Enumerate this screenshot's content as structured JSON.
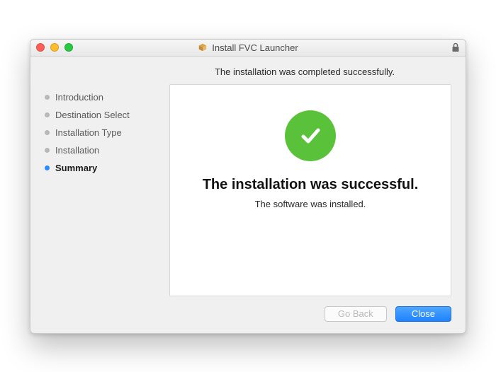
{
  "window": {
    "title": "Install FVC Launcher"
  },
  "status": "The installation was completed successfully.",
  "sidebar": {
    "items": [
      {
        "label": "Introduction",
        "active": false
      },
      {
        "label": "Destination Select",
        "active": false
      },
      {
        "label": "Installation Type",
        "active": false
      },
      {
        "label": "Installation",
        "active": false
      },
      {
        "label": "Summary",
        "active": true
      }
    ]
  },
  "panel": {
    "headline": "The installation was successful.",
    "subline": "The software was installed."
  },
  "buttons": {
    "back": "Go Back",
    "close": "Close"
  }
}
